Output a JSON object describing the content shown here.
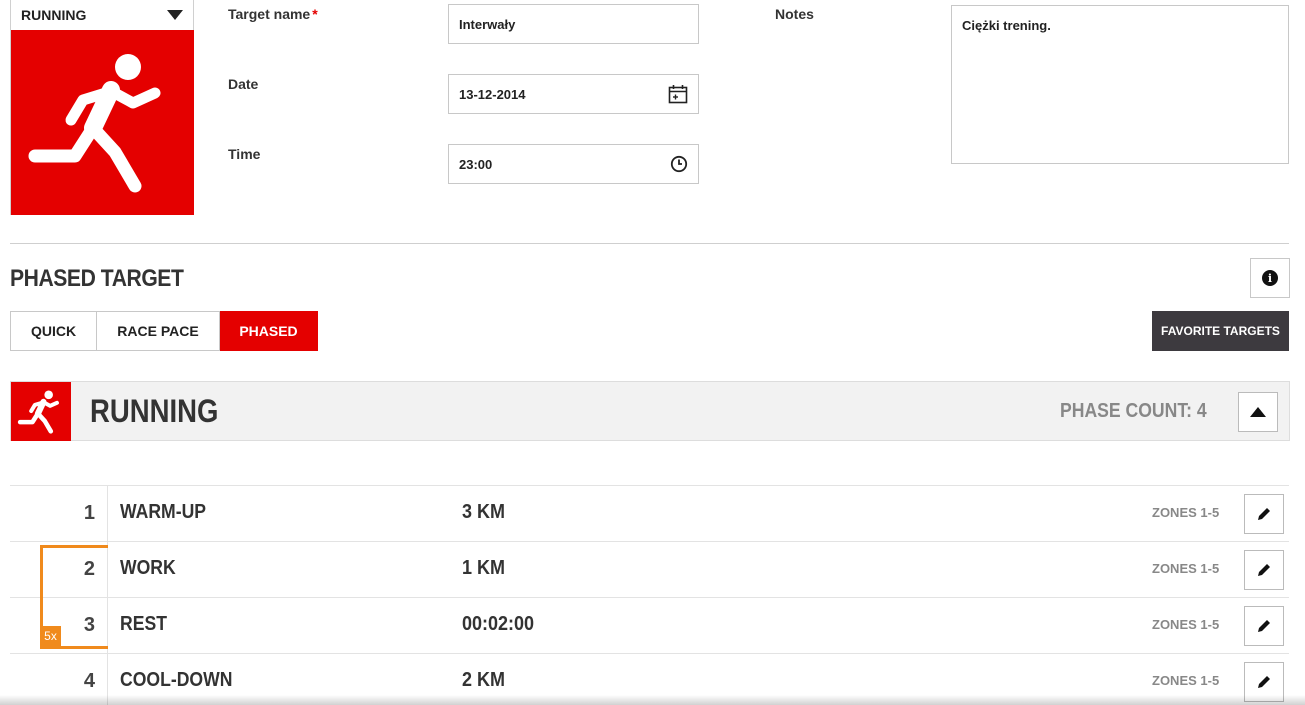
{
  "sport_selector": {
    "selected": "RUNNING",
    "icon": "running-person-icon",
    "color": "#e40000"
  },
  "form": {
    "target_name": {
      "label": "Target name",
      "required_mark": "*",
      "value": "Interwały"
    },
    "date": {
      "label": "Date",
      "value": "13-12-2014",
      "icon": "calendar-icon"
    },
    "time": {
      "label": "Time",
      "value": "23:00",
      "icon": "clock-icon"
    },
    "notes": {
      "label": "Notes",
      "value": "Ciężki trening."
    }
  },
  "section": {
    "title": "PHASED TARGET",
    "info_icon": "info-icon",
    "tabs": [
      {
        "label": "QUICK",
        "active": false
      },
      {
        "label": "RACE PACE",
        "active": false
      },
      {
        "label": "PHASED",
        "active": true
      }
    ],
    "favorite_button": "FAVORITE TARGETS"
  },
  "phases_panel": {
    "sport": "RUNNING",
    "phase_count": "PHASE COUNT: 4",
    "collapse_icon": "chevron-up-icon",
    "repeat": {
      "label": "5x",
      "color": "#f08a1c"
    },
    "phases": [
      {
        "number": "1",
        "name": "WARM-UP",
        "value": "3 KM",
        "zones": "ZONES 1-5"
      },
      {
        "number": "2",
        "name": "WORK",
        "value": "1 KM",
        "zones": "ZONES 1-5"
      },
      {
        "number": "3",
        "name": "REST",
        "value": "00:02:00",
        "zones": "ZONES 1-5"
      },
      {
        "number": "4",
        "name": "COOL-DOWN",
        "value": "2 KM",
        "zones": "ZONES 1-5"
      }
    ]
  },
  "colors": {
    "accent": "#e40000",
    "dark_button": "#3d3a3f",
    "repeat": "#f08a1c"
  }
}
